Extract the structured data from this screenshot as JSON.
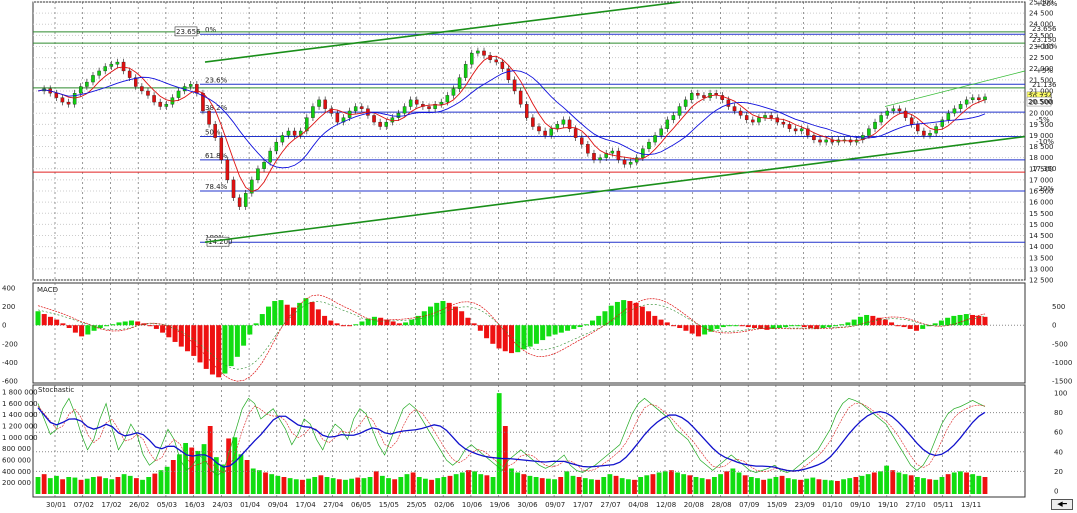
{
  "chart_data": [
    {
      "type": "candlestick",
      "title": "",
      "y_axis": {
        "min": 12500,
        "max": 25000,
        "step": 500
      },
      "x_ticks": [
        "30/01",
        "07/02",
        "17/02",
        "26/02",
        "05/03",
        "16/03",
        "24/03",
        "01/04",
        "09/04",
        "17/04",
        "27/04",
        "06/05",
        "15/05",
        "25/05",
        "02/06",
        "10/06",
        "19/06",
        "30/06",
        "09/07",
        "17/07",
        "27/07",
        "04/08",
        "12/08",
        "20/08",
        "28/08",
        "07/09",
        "15/09",
        "23/09",
        "01/10",
        "09/10",
        "19/10",
        "27/10",
        "05/11",
        "13/11"
      ],
      "fib_levels": [
        {
          "label": "0%",
          "value": 23550
        },
        {
          "label": "23.6%",
          "value": 21300
        },
        {
          "label": "38.2%",
          "value": 20050
        },
        {
          "label": "50%",
          "value": 18950
        },
        {
          "label": "61.8%",
          "value": 17900
        },
        {
          "label": "78.4%",
          "value": 16500
        },
        {
          "label": "100%",
          "value": 14200
        }
      ],
      "horizontal_levels": [
        {
          "label": "23.656",
          "value": 23656,
          "color": "#2e8b2e"
        },
        {
          "label": "23.150",
          "value": 23150,
          "color": "#2e8b2e"
        },
        {
          "label": "21.136",
          "value": 21136,
          "color": "#2e8b2e"
        },
        {
          "label": "17.350",
          "value": 17350,
          "color": "#e02020"
        }
      ],
      "right_tags": [
        {
          "label": "+20%",
          "value": 24900,
          "color": "#2e8b2e"
        },
        {
          "label": "+10%",
          "value": 23000,
          "color": "#2e8b2e"
        },
        {
          "label": "+5%",
          "value": 21900,
          "color": "#2e8b2e"
        },
        {
          "label": "-5%",
          "value": 19700,
          "color": "#e02020"
        },
        {
          "label": "-10%",
          "value": 18700,
          "color": "#e02020"
        },
        {
          "label": "-20%",
          "value": 16600,
          "color": "#e02020"
        }
      ],
      "price_tags": [
        {
          "label": "20.734",
          "value": 20734,
          "bg": "#ffff66"
        },
        {
          "label": "20.500",
          "value": 20500,
          "bg": "#ffffff"
        }
      ],
      "annotations": [
        {
          "label": "23.656",
          "value": 23656
        },
        {
          "label": "14.200",
          "value": 14200
        }
      ],
      "close": [
        21000,
        21100,
        20900,
        20700,
        20500,
        20400,
        20900,
        21200,
        21400,
        21700,
        21900,
        22100,
        22200,
        22300,
        21900,
        21600,
        21200,
        21000,
        20800,
        20500,
        20300,
        20400,
        20700,
        21000,
        21200,
        21300,
        20900,
        20100,
        19500,
        18900,
        17900,
        17000,
        16200,
        15800,
        16400,
        17000,
        17500,
        17800,
        18300,
        18700,
        19000,
        19200,
        19000,
        19200,
        19800,
        20300,
        20600,
        20200,
        20000,
        19600,
        19800,
        20100,
        20300,
        20200,
        19900,
        19600,
        19400,
        19600,
        19800,
        20000,
        20300,
        20600,
        20400,
        20300,
        20200,
        20400,
        20500,
        20800,
        21100,
        21600,
        22200,
        22700,
        22800,
        22600,
        22400,
        22300,
        22000,
        21500,
        21000,
        20400,
        19800,
        19400,
        19200,
        19000,
        19300,
        19500,
        19700,
        19300,
        18900,
        18600,
        18200,
        17900,
        18000,
        18200,
        18300,
        17900,
        17700,
        17800,
        18000,
        18400,
        18700,
        19000,
        19300,
        19700,
        19900,
        20300,
        20600,
        20900,
        20800,
        20700,
        20900,
        20800,
        20600,
        20300,
        20100,
        19900,
        19700,
        19600,
        19800,
        19900,
        19800,
        19600,
        19500,
        19300,
        19200,
        19300,
        19000,
        18800,
        18700,
        18800,
        18700,
        18800,
        18800,
        18700,
        18800,
        19000,
        19300,
        19600,
        19900,
        20100,
        20200,
        20100,
        19800,
        19500,
        19200,
        19000,
        19100,
        19400,
        19700,
        20000,
        20200,
        20400,
        20600,
        20700,
        20600,
        20734
      ]
    },
    {
      "type": "bar",
      "title": "MACD",
      "y_axis_left": {
        "ticks": [
          400,
          200,
          0,
          -200,
          -400,
          -600
        ]
      },
      "y_axis_right": {
        "ticks": [
          500,
          0,
          -500,
          -1000,
          -1500
        ]
      },
      "values": [
        150,
        120,
        90,
        60,
        20,
        -30,
        -80,
        -120,
        -100,
        -60,
        -30,
        -10,
        10,
        30,
        40,
        50,
        40,
        20,
        -10,
        -40,
        -80,
        -130,
        -180,
        -230,
        -280,
        -330,
        -400,
        -470,
        -530,
        -560,
        -520,
        -440,
        -340,
        -220,
        -100,
        20,
        120,
        200,
        260,
        270,
        220,
        190,
        240,
        290,
        250,
        170,
        100,
        50,
        20,
        0,
        -10,
        10,
        40,
        70,
        90,
        80,
        60,
        40,
        20,
        30,
        60,
        100,
        150,
        200,
        240,
        260,
        240,
        200,
        150,
        80,
        20,
        -60,
        -140,
        -200,
        -250,
        -280,
        -300,
        -290,
        -260,
        -230,
        -200,
        -160,
        -120,
        -100,
        -80,
        -60,
        -40,
        -20,
        10,
        50,
        100,
        150,
        210,
        250,
        270,
        260,
        240,
        200,
        150,
        100,
        60,
        30,
        0,
        -30,
        -60,
        -90,
        -120,
        -100,
        -70,
        -40,
        -20,
        -10,
        0,
        -10,
        -20,
        -30,
        -40,
        -50,
        -40,
        -30,
        -20,
        -10,
        -10,
        -20,
        -30,
        -40,
        -30,
        -20,
        -10,
        10,
        30,
        60,
        90,
        110,
        100,
        80,
        60,
        30,
        0,
        -20,
        -40,
        -60,
        -40,
        -10,
        20,
        50,
        80,
        100,
        110,
        120,
        110,
        100,
        90
      ]
    },
    {
      "type": "bar+line",
      "title": "Stochastic",
      "y_axis_left": {
        "ticks": [
          "1 800 000",
          "1 600 000",
          "1 400 000",
          "1 200 000",
          "1 000 000",
          "800 000",
          "600 000",
          "400 000",
          "200 000"
        ]
      },
      "y_axis_right": {
        "ticks": [
          100,
          80,
          60,
          40,
          20,
          0
        ]
      },
      "volume": [
        300000,
        350000,
        280000,
        320000,
        260000,
        300000,
        290000,
        250000,
        270000,
        300000,
        310000,
        280000,
        260000,
        300000,
        350000,
        320000,
        280000,
        250000,
        300000,
        360000,
        420000,
        480000,
        600000,
        700000,
        900000,
        820000,
        760000,
        880000,
        1200000,
        650000,
        520000,
        980000,
        1000000,
        700000,
        600000,
        450000,
        420000,
        380000,
        350000,
        320000,
        300000,
        280000,
        260000,
        250000,
        270000,
        300000,
        330000,
        300000,
        280000,
        260000,
        250000,
        270000,
        290000,
        280000,
        300000,
        400000,
        320000,
        280000,
        260000,
        300000,
        350000,
        380000,
        300000,
        270000,
        250000,
        280000,
        300000,
        320000,
        350000,
        380000,
        420000,
        400000,
        350000,
        330000,
        300000,
        1780000,
        1200000,
        450000,
        380000,
        350000,
        320000,
        300000,
        280000,
        270000,
        260000,
        300000,
        400000,
        320000,
        300000,
        280000,
        260000,
        250000,
        300000,
        350000,
        320000,
        280000,
        260000,
        250000,
        300000,
        330000,
        350000,
        380000,
        400000,
        420000,
        380000,
        350000,
        330000,
        300000,
        280000,
        260000,
        300000,
        350000,
        400000,
        450000,
        380000,
        330000,
        300000,
        280000,
        250000,
        270000,
        300000,
        320000,
        280000,
        260000,
        250000,
        270000,
        290000,
        260000,
        250000,
        240000,
        230000,
        260000,
        280000,
        300000,
        320000,
        350000,
        380000,
        400000,
        500000,
        420000,
        380000,
        350000,
        330000,
        300000,
        280000,
        260000,
        250000,
        300000,
        350000,
        380000,
        400000,
        380000,
        350000,
        320000,
        300000
      ],
      "k_line": [
        85,
        70,
        55,
        60,
        80,
        90,
        75,
        55,
        40,
        50,
        70,
        85,
        60,
        40,
        50,
        65,
        55,
        35,
        25,
        30,
        45,
        60,
        50,
        30,
        20,
        25,
        35,
        30,
        20,
        15,
        20,
        40,
        60,
        80,
        90,
        85,
        70,
        75,
        80,
        70,
        60,
        45,
        55,
        70,
        65,
        50,
        40,
        55,
        65,
        60,
        50,
        70,
        80,
        75,
        60,
        45,
        35,
        50,
        65,
        80,
        85,
        80,
        70,
        60,
        50,
        40,
        30,
        25,
        30,
        40,
        45,
        40,
        35,
        30,
        25,
        20,
        30,
        35,
        40,
        35,
        30,
        25,
        22,
        25,
        30,
        35,
        25,
        20,
        18,
        22,
        25,
        30,
        35,
        40,
        45,
        60,
        75,
        85,
        90,
        85,
        80,
        75,
        70,
        60,
        55,
        50,
        40,
        30,
        25,
        20,
        25,
        30,
        35,
        30,
        25,
        20,
        18,
        20,
        22,
        25,
        20,
        18,
        20,
        25,
        30,
        35,
        40,
        50,
        60,
        75,
        85,
        90,
        88,
        85,
        80,
        75,
        70,
        65,
        55,
        45,
        35,
        25,
        20,
        25,
        35,
        50,
        65,
        75,
        80,
        82,
        85,
        88,
        85,
        82
      ]
    }
  ],
  "ui": {
    "scroll_button": "◀━"
  }
}
